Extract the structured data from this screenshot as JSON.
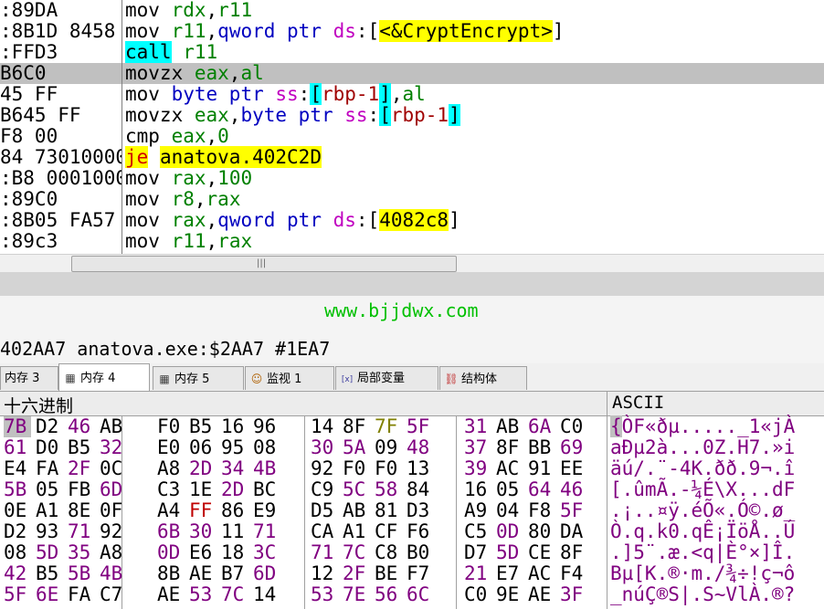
{
  "disasm": [
    {
      "addr": ":89DA",
      "parts": [
        [
          "mov ",
          "mn"
        ],
        [
          "rdx",
          "reg"
        ],
        [
          ",",
          "br"
        ],
        [
          "r11",
          "reg"
        ]
      ]
    },
    {
      "addr": ":8B1D 8458",
      "parts": [
        [
          "mov ",
          "mn"
        ],
        [
          "r11",
          "reg"
        ],
        [
          ",",
          "br"
        ],
        [
          "qword ",
          "kw"
        ],
        [
          "ptr ",
          "kw"
        ],
        [
          "ds",
          "seg"
        ],
        [
          ":[",
          "br"
        ],
        [
          "<&CryptEncrypt>",
          "hl-y"
        ],
        [
          "]",
          "br"
        ]
      ]
    },
    {
      "addr": ":FFD3",
      "parts": [
        [
          "call",
          "mn-call"
        ],
        [
          " ",
          "br"
        ],
        [
          "r11",
          "reg"
        ]
      ]
    },
    {
      "addr": "B6C0",
      "selected": true,
      "parts": [
        [
          "movzx ",
          "mn"
        ],
        [
          "eax",
          "reg"
        ],
        [
          ",",
          "br"
        ],
        [
          "al",
          "reg"
        ]
      ]
    },
    {
      "addr": "45 FF",
      "parts": [
        [
          "mov ",
          "mn"
        ],
        [
          "byte ",
          "kw"
        ],
        [
          "ptr ",
          "kw"
        ],
        [
          "ss",
          "seg"
        ],
        [
          ":",
          "br"
        ],
        [
          "[",
          "hl-c"
        ],
        [
          "rbp-1",
          "mem"
        ],
        [
          "]",
          "hl-c"
        ],
        [
          ",",
          "br"
        ],
        [
          "al",
          "reg"
        ]
      ]
    },
    {
      "addr": "B645 FF",
      "parts": [
        [
          "movzx ",
          "mn"
        ],
        [
          "eax",
          "reg"
        ],
        [
          ",",
          "br"
        ],
        [
          "byte ",
          "kw"
        ],
        [
          "ptr ",
          "kw"
        ],
        [
          "ss",
          "seg"
        ],
        [
          ":",
          "br"
        ],
        [
          "[",
          "hl-c"
        ],
        [
          "rbp-1",
          "mem"
        ],
        [
          "]",
          "hl-c"
        ]
      ]
    },
    {
      "addr": "F8 00",
      "parts": [
        [
          "cmp ",
          "mn"
        ],
        [
          "eax",
          "reg"
        ],
        [
          ",",
          "br"
        ],
        [
          "0",
          "num"
        ]
      ]
    },
    {
      "addr": "84 73010000",
      "parts": [
        [
          "je",
          "mn-je"
        ],
        [
          " ",
          "br"
        ],
        [
          "anatova.402C2D",
          "hl-y"
        ]
      ]
    },
    {
      "addr": ":B8 00010000",
      "parts": [
        [
          "mov ",
          "mn"
        ],
        [
          "rax",
          "reg"
        ],
        [
          ",",
          "br"
        ],
        [
          "100",
          "num"
        ]
      ]
    },
    {
      "addr": ":89C0",
      "parts": [
        [
          "mov ",
          "mn"
        ],
        [
          "r8",
          "reg"
        ],
        [
          ",",
          "br"
        ],
        [
          "rax",
          "reg"
        ]
      ]
    },
    {
      "addr": ":8B05 FA57",
      "parts": [
        [
          "mov ",
          "mn"
        ],
        [
          "rax",
          "reg"
        ],
        [
          ",",
          "br"
        ],
        [
          "qword ",
          "kw"
        ],
        [
          "ptr ",
          "kw"
        ],
        [
          "ds",
          "seg"
        ],
        [
          ":[",
          "br"
        ],
        [
          "4082c8",
          "hl-y"
        ],
        [
          "]",
          "br"
        ]
      ]
    },
    {
      "addr": ":89c3",
      "parts": [
        [
          "mov ",
          "mn"
        ],
        [
          "r11",
          "reg"
        ],
        [
          ",",
          "br"
        ],
        [
          "rax",
          "reg"
        ]
      ]
    }
  ],
  "watermark": "www.bjjdwx.com",
  "info_line": "402AA7 anatova.exe:$2AA7 #1EA7",
  "tabs": [
    {
      "label": "内存 3",
      "icon": "",
      "active": false
    },
    {
      "label": "内存 4",
      "icon": "memory-icon",
      "active": true
    },
    {
      "label": "内存 5",
      "icon": "memory-icon",
      "active": false
    },
    {
      "label": "监视 1",
      "icon": "watch-icon",
      "active": false
    },
    {
      "label": "局部变量",
      "icon": "locals-icon",
      "active": false
    },
    {
      "label": "结构体",
      "icon": "struct-icon",
      "active": false
    }
  ],
  "dump": {
    "hex_header": "十六进制",
    "ascii_header": "ASCII",
    "rows": [
      {
        "bytes": [
          [
            "7B",
            "p"
          ],
          [
            "D2",
            "b"
          ],
          [
            "46",
            "p"
          ],
          [
            "AB",
            "b"
          ],
          [
            "F0",
            "b"
          ],
          [
            "B5",
            "b"
          ],
          [
            "16",
            "b"
          ],
          [
            "96",
            "b"
          ],
          [
            "14",
            "b"
          ],
          [
            "8F",
            "b"
          ],
          [
            "7F",
            "o"
          ],
          [
            "5F",
            "p"
          ],
          [
            "31",
            "p"
          ],
          [
            "AB",
            "b"
          ],
          [
            "6A",
            "p"
          ],
          [
            "C0",
            "b"
          ]
        ],
        "ascii": "{ÒF«ðµ....._1«jÀ"
      },
      {
        "bytes": [
          [
            "61",
            "p"
          ],
          [
            "D0",
            "b"
          ],
          [
            "B5",
            "b"
          ],
          [
            "32",
            "p"
          ],
          [
            "E0",
            "b"
          ],
          [
            "06",
            "b"
          ],
          [
            "95",
            "b"
          ],
          [
            "08",
            "b"
          ],
          [
            "30",
            "p"
          ],
          [
            "5A",
            "p"
          ],
          [
            "09",
            "b"
          ],
          [
            "48",
            "p"
          ],
          [
            "37",
            "p"
          ],
          [
            "8F",
            "b"
          ],
          [
            "BB",
            "b"
          ],
          [
            "69",
            "p"
          ]
        ],
        "ascii": "aÐµ2à...0Z.H7.»i"
      },
      {
        "bytes": [
          [
            "E4",
            "b"
          ],
          [
            "FA",
            "b"
          ],
          [
            "2F",
            "p"
          ],
          [
            "0C",
            "b"
          ],
          [
            "A8",
            "b"
          ],
          [
            "2D",
            "p"
          ],
          [
            "34",
            "p"
          ],
          [
            "4B",
            "p"
          ],
          [
            "92",
            "b"
          ],
          [
            "F0",
            "b"
          ],
          [
            "F0",
            "b"
          ],
          [
            "13",
            "b"
          ],
          [
            "39",
            "p"
          ],
          [
            "AC",
            "b"
          ],
          [
            "91",
            "b"
          ],
          [
            "EE",
            "b"
          ]
        ],
        "ascii": "äú/.¨-4K.ðð.9¬.î"
      },
      {
        "bytes": [
          [
            "5B",
            "p"
          ],
          [
            "05",
            "b"
          ],
          [
            "FB",
            "b"
          ],
          [
            "6D",
            "p"
          ],
          [
            "C3",
            "b"
          ],
          [
            "1E",
            "b"
          ],
          [
            "2D",
            "p"
          ],
          [
            "BC",
            "b"
          ],
          [
            "C9",
            "b"
          ],
          [
            "5C",
            "p"
          ],
          [
            "58",
            "p"
          ],
          [
            "84",
            "b"
          ],
          [
            "16",
            "b"
          ],
          [
            "05",
            "b"
          ],
          [
            "64",
            "p"
          ],
          [
            "46",
            "p"
          ]
        ],
        "ascii": "[.ûmÃ.-¼É\\X...dF"
      },
      {
        "bytes": [
          [
            "0E",
            "b"
          ],
          [
            "A1",
            "b"
          ],
          [
            "8E",
            "b"
          ],
          [
            "0F",
            "b"
          ],
          [
            "A4",
            "b"
          ],
          [
            "FF",
            "r"
          ],
          [
            "86",
            "b"
          ],
          [
            "E9",
            "b"
          ],
          [
            "D5",
            "b"
          ],
          [
            "AB",
            "b"
          ],
          [
            "81",
            "b"
          ],
          [
            "D3",
            "b"
          ],
          [
            "A9",
            "b"
          ],
          [
            "04",
            "b"
          ],
          [
            "F8",
            "b"
          ],
          [
            "5F",
            "p"
          ]
        ],
        "ascii": ".¡..¤ÿ.éÕ«.Ó©.ø_"
      },
      {
        "bytes": [
          [
            "D2",
            "b"
          ],
          [
            "93",
            "b"
          ],
          [
            "71",
            "p"
          ],
          [
            "92",
            "b"
          ],
          [
            "6B",
            "p"
          ],
          [
            "30",
            "p"
          ],
          [
            "11",
            "b"
          ],
          [
            "71",
            "p"
          ],
          [
            "CA",
            "b"
          ],
          [
            "A1",
            "b"
          ],
          [
            "CF",
            "b"
          ],
          [
            "F6",
            "b"
          ],
          [
            "C5",
            "b"
          ],
          [
            "0D",
            "p"
          ],
          [
            "80",
            "b"
          ],
          [
            "DA",
            "b"
          ]
        ],
        "ascii": "Ò.q.k0.qÊ¡ÏöÅ..Ú"
      },
      {
        "bytes": [
          [
            "08",
            "b"
          ],
          [
            "5D",
            "p"
          ],
          [
            "35",
            "p"
          ],
          [
            "A8",
            "b"
          ],
          [
            "0D",
            "p"
          ],
          [
            "E6",
            "b"
          ],
          [
            "18",
            "b"
          ],
          [
            "3C",
            "p"
          ],
          [
            "71",
            "p"
          ],
          [
            "7C",
            "p"
          ],
          [
            "C8",
            "b"
          ],
          [
            "B0",
            "b"
          ],
          [
            "D7",
            "b"
          ],
          [
            "5D",
            "p"
          ],
          [
            "CE",
            "b"
          ],
          [
            "8F",
            "b"
          ]
        ],
        "ascii": ".]5¨.æ.<q|È°×]Î."
      },
      {
        "bytes": [
          [
            "42",
            "p"
          ],
          [
            "B5",
            "b"
          ],
          [
            "5B",
            "p"
          ],
          [
            "4B",
            "p"
          ],
          [
            "8B",
            "b"
          ],
          [
            "AE",
            "b"
          ],
          [
            "B7",
            "b"
          ],
          [
            "6D",
            "p"
          ],
          [
            "12",
            "b"
          ],
          [
            "2F",
            "p"
          ],
          [
            "BE",
            "b"
          ],
          [
            "F7",
            "b"
          ],
          [
            "21",
            "p"
          ],
          [
            "E7",
            "b"
          ],
          [
            "AC",
            "b"
          ],
          [
            "F4",
            "b"
          ]
        ],
        "ascii": "Bµ[K.®·m./¾÷!ç¬ô"
      },
      {
        "bytes": [
          [
            "5F",
            "p"
          ],
          [
            "6E",
            "p"
          ],
          [
            "FA",
            "b"
          ],
          [
            "C7",
            "b"
          ],
          [
            "AE",
            "b"
          ],
          [
            "53",
            "p"
          ],
          [
            "7C",
            "p"
          ],
          [
            "14",
            "b"
          ],
          [
            "53",
            "p"
          ],
          [
            "7E",
            "p"
          ],
          [
            "56",
            "p"
          ],
          [
            "6C",
            "p"
          ],
          [
            "C0",
            "b"
          ],
          [
            "9E",
            "b"
          ],
          [
            "AE",
            "b"
          ],
          [
            "3F",
            "p"
          ]
        ],
        "ascii": "_núÇ®S|.S~VlÀ.®?"
      }
    ]
  },
  "colors": {
    "reg": "#008000",
    "seg": "#c000c0",
    "keyword": "#0000c0",
    "highlight_yellow": "#ffff00",
    "highlight_cyan": "#00ffff",
    "byte_purple": "#800080",
    "watermark": "#00c000"
  }
}
